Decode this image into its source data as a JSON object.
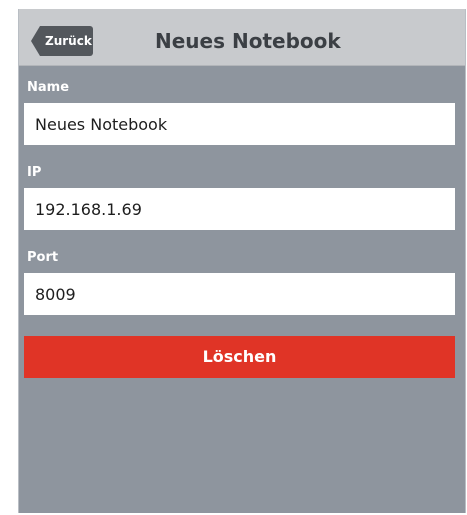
{
  "navbar": {
    "back_label": "Zurück",
    "title": "Neues Notebook"
  },
  "form": {
    "name": {
      "label": "Name",
      "value": "Neues Notebook"
    },
    "ip": {
      "label": "IP",
      "value": "192.168.1.69"
    },
    "port": {
      "label": "Port",
      "value": "8009"
    }
  },
  "actions": {
    "delete_label": "Löschen"
  },
  "colors": {
    "background": "#8e959e",
    "navbar": "#c8cacd",
    "back_button": "#53575c",
    "delete_button": "#e03426"
  }
}
